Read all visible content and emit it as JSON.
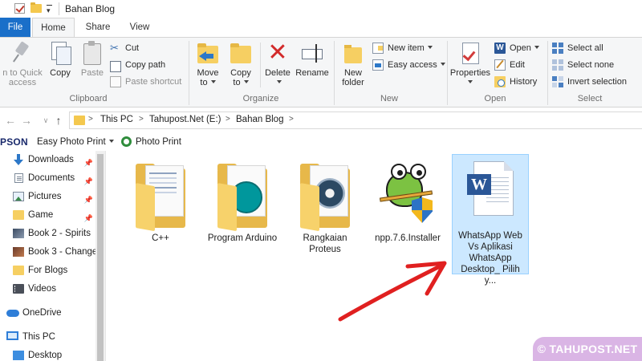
{
  "window": {
    "title": "Bahan Blog"
  },
  "ribbon_tabs": [
    "File",
    "Home",
    "Share",
    "View"
  ],
  "ribbon": {
    "clipboard": {
      "label": "Clipboard",
      "pin_label": "n to Quick access",
      "copy_label": "Copy",
      "paste_label": "Paste",
      "cut_label": "Cut",
      "copy_path_label": "Copy path",
      "paste_shortcut_label": "Paste shortcut"
    },
    "organize": {
      "label": "Organize",
      "move_to_label": "Move to",
      "copy_to_label": "Copy to",
      "delete_label": "Delete",
      "rename_label": "Rename"
    },
    "new": {
      "label": "New",
      "new_folder_label": "New folder",
      "new_item_label": "New item",
      "easy_access_label": "Easy access"
    },
    "open": {
      "label": "Open",
      "properties_label": "Properties",
      "open_label": "Open",
      "edit_label": "Edit",
      "history_label": "History"
    },
    "select": {
      "label": "Select",
      "select_all_label": "Select all",
      "select_none_label": "Select none",
      "invert_label": "Invert selection"
    }
  },
  "address": {
    "crumbs": [
      "This PC",
      "Tahupost.Net (E:)",
      "Bahan Blog"
    ]
  },
  "toolbar2": {
    "brand": "PSON",
    "easy_photo_print": "Easy Photo Print",
    "photo_print": "Photo Print"
  },
  "nav_pane": {
    "items": [
      {
        "label": "Downloads",
        "icon": "download-arrow-icon",
        "pinned": true
      },
      {
        "label": "Documents",
        "icon": "documents-icon",
        "pinned": true
      },
      {
        "label": "Pictures",
        "icon": "pictures-icon",
        "pinned": true
      },
      {
        "label": "Game",
        "icon": "folder-icon",
        "pinned": true
      },
      {
        "label": "Book 2 - Spirits",
        "icon": "folder-thumbnail-icon",
        "pinned": false
      },
      {
        "label": "Book 3 - Change",
        "icon": "folder-thumbnail-icon",
        "pinned": false
      },
      {
        "label": "For Blogs",
        "icon": "folder-icon",
        "pinned": false
      },
      {
        "label": "Videos",
        "icon": "videos-icon",
        "pinned": false
      },
      {
        "label": "OneDrive",
        "icon": "onedrive-cloud-icon",
        "pinned": false
      },
      {
        "label": "This PC",
        "icon": "this-pc-icon",
        "pinned": false
      },
      {
        "label": "Desktop",
        "icon": "desktop-icon",
        "pinned": false
      }
    ],
    "pin_glyph": "📌"
  },
  "files": [
    {
      "label": "C++",
      "type": "folder",
      "selected": false
    },
    {
      "label": "Program Arduino",
      "type": "folder",
      "selected": false
    },
    {
      "label": "Rangkaian Proteus",
      "type": "folder",
      "selected": false
    },
    {
      "label": "npp.7.6.Installer",
      "type": "installer",
      "selected": false
    },
    {
      "label": "WhatsApp Web Vs Aplikasi WhatsApp Desktop_ Pilih y...",
      "type": "word-document",
      "selected": true
    }
  ],
  "watermark": "© TAHUPOST.NET",
  "colors": {
    "file_tab": "#1a6fc9",
    "selection_bg": "#cce8ff",
    "selection_border": "#99d1ff",
    "annotation_arrow": "#e02020",
    "delete_x": "#d22a2a"
  }
}
